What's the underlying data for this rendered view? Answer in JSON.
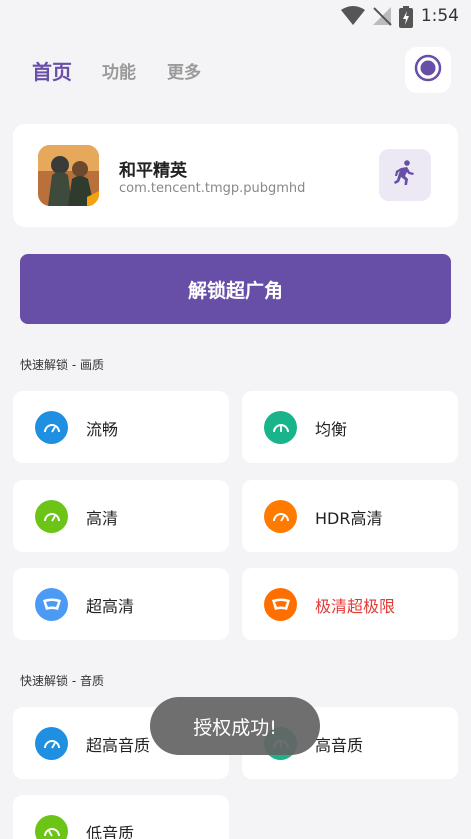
{
  "status_bar": {
    "time": "1:54"
  },
  "nav": {
    "tabs": [
      "首页",
      "功能",
      "更多"
    ]
  },
  "app": {
    "name": "和平精英",
    "package": "com.tencent.tmgp.pubgmhd"
  },
  "unlock_button": "解锁超广角",
  "quality_section": {
    "title": "快速解锁 - 画质",
    "options": [
      {
        "label": "流畅",
        "color": "#1e8fe1"
      },
      {
        "label": "均衡",
        "color": "#19b48a"
      },
      {
        "label": "高清",
        "color": "#6cc516"
      },
      {
        "label": "HDR高清",
        "color": "#ff7a00"
      },
      {
        "label": "超高清",
        "color": "#4b9bf5"
      },
      {
        "label": "极清超极限",
        "color": "#ff6f00",
        "text_color": "#e53935"
      }
    ]
  },
  "audio_section": {
    "title": "快速解锁 - 音质",
    "options": [
      {
        "label": "超高音质",
        "color": "#1e8fe1"
      },
      {
        "label": "高音质",
        "color": "#19b48a"
      },
      {
        "label": "低音质",
        "color": "#6cc516"
      }
    ]
  },
  "toast": "授权成功!",
  "colors": {
    "accent": "#674ea7",
    "background": "#f4f4f6"
  }
}
